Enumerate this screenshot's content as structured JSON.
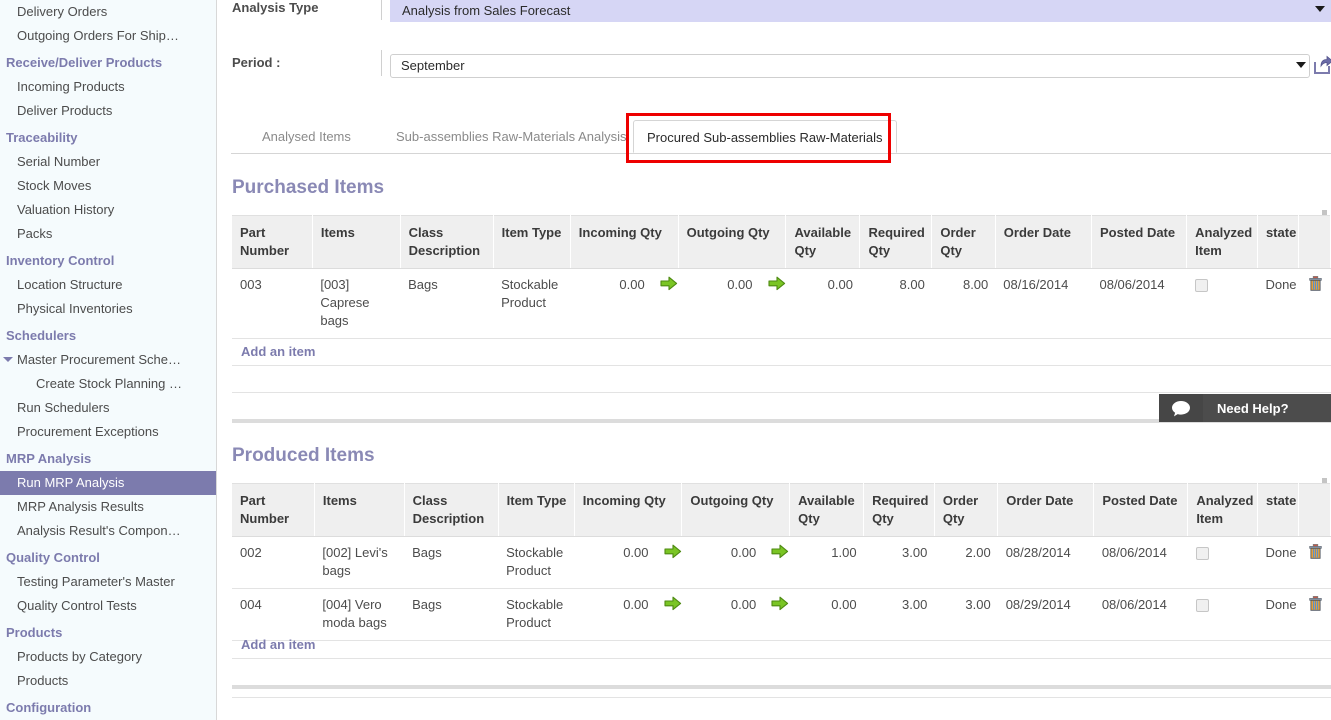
{
  "sidebar": {
    "items": [
      {
        "type": "item",
        "label": "Delivery Orders"
      },
      {
        "type": "item",
        "label": "Outgoing Orders For Ship…"
      },
      {
        "type": "section",
        "label": "Receive/Deliver Products"
      },
      {
        "type": "item",
        "label": "Incoming Products"
      },
      {
        "type": "item",
        "label": "Deliver Products"
      },
      {
        "type": "section",
        "label": "Traceability"
      },
      {
        "type": "item",
        "label": "Serial Number"
      },
      {
        "type": "item",
        "label": "Stock Moves"
      },
      {
        "type": "item",
        "label": "Valuation History"
      },
      {
        "type": "item",
        "label": "Packs"
      },
      {
        "type": "section",
        "label": "Inventory Control"
      },
      {
        "type": "item",
        "label": "Location Structure"
      },
      {
        "type": "item",
        "label": "Physical Inventories"
      },
      {
        "type": "section",
        "label": "Schedulers"
      },
      {
        "type": "toggler",
        "label": "Master Procurement Sche…"
      },
      {
        "type": "sub",
        "label": "Create Stock Planning …"
      },
      {
        "type": "item",
        "label": "Run Schedulers"
      },
      {
        "type": "item",
        "label": "Procurement Exceptions"
      },
      {
        "type": "section",
        "label": "MRP Analysis"
      },
      {
        "type": "active",
        "label": "Run MRP Analysis"
      },
      {
        "type": "item",
        "label": "MRP Analysis Results"
      },
      {
        "type": "item",
        "label": "Analysis Result's Compon…"
      },
      {
        "type": "section",
        "label": "Quality Control"
      },
      {
        "type": "item",
        "label": "Testing Parameter's Master"
      },
      {
        "type": "item",
        "label": "Quality Control Tests"
      },
      {
        "type": "section",
        "label": "Products"
      },
      {
        "type": "item",
        "label": "Products by Category"
      },
      {
        "type": "item",
        "label": "Products"
      },
      {
        "type": "section",
        "label": "Configuration"
      }
    ]
  },
  "form": {
    "analysis_type_label": "Analysis Type",
    "analysis_type_value": "Analysis from Sales Forecast",
    "period_label": "Period :",
    "period_value": "September",
    "export_icon": "external-link-icon"
  },
  "tabs": [
    {
      "label": "Analysed Items",
      "active": false
    },
    {
      "label": "Sub-assemblies Raw-Materials Analysis",
      "active": false
    },
    {
      "label": "Procured Sub-assemblies Raw-Materials",
      "active": true
    }
  ],
  "columns": [
    "Part Number",
    "Items",
    "Class Description",
    "Item Type",
    "Incoming Qty",
    "",
    "Outgoing Qty",
    "",
    "Available Qty",
    "Required Qty",
    "Order Qty",
    "Order Date",
    "Posted Date",
    "Analyzed Item",
    "state",
    ""
  ],
  "purchased": {
    "title": "Purchased Items",
    "add_label": "Add an item",
    "rows": [
      {
        "part_number": "003",
        "item": "[003] Caprese bags",
        "class_description": "Bags",
        "item_type": "Stockable Product",
        "incoming_qty": "0.00",
        "outgoing_qty": "0.00",
        "available_qty": "0.00",
        "required_qty": "8.00",
        "order_qty": "8.00",
        "order_date": "08/16/2014",
        "posted_date": "08/06/2014",
        "analyzed_item": false,
        "state": "Done"
      }
    ]
  },
  "produced": {
    "title": "Produced Items",
    "add_label": "Add an item",
    "rows": [
      {
        "part_number": "002",
        "item": "[002] Levi's bags",
        "class_description": "Bags",
        "item_type": "Stockable Product",
        "incoming_qty": "0.00",
        "outgoing_qty": "0.00",
        "available_qty": "1.00",
        "required_qty": "3.00",
        "order_qty": "2.00",
        "order_date": "08/28/2014",
        "posted_date": "08/06/2014",
        "analyzed_item": false,
        "state": "Done"
      },
      {
        "part_number": "004",
        "item": "[004] Vero moda bags",
        "class_description": "Bags",
        "item_type": "Stockable Product",
        "incoming_qty": "0.00",
        "outgoing_qty": "0.00",
        "available_qty": "0.00",
        "required_qty": "3.00",
        "order_qty": "3.00",
        "order_date": "08/29/2014",
        "posted_date": "08/06/2014",
        "analyzed_item": false,
        "state": "Done"
      }
    ]
  },
  "need_help": {
    "label": "Need Help?",
    "icon": "chat-bubble-icon"
  },
  "colors": {
    "accent": "#7c7bad",
    "highlight_field": "#d6d6f5",
    "tab_highlight_border": "#ee0000",
    "arrow_green": "#73b827",
    "sidebar_bg": "#f5fbfd"
  }
}
